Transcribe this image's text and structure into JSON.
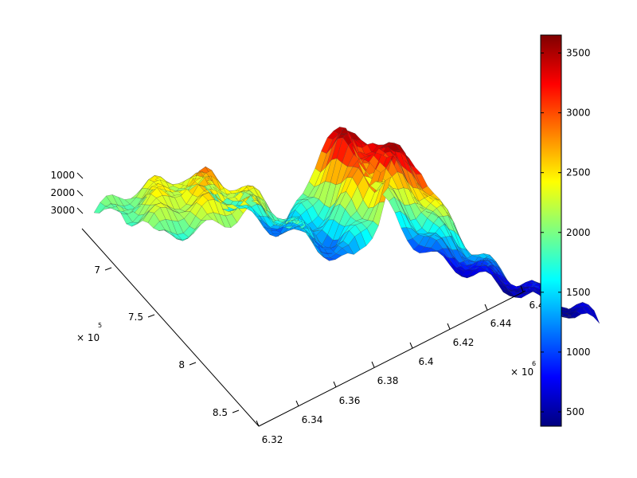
{
  "chart_data": {
    "type": "surface3d",
    "colormap": "jet",
    "x_axis": {
      "ticks": [
        "6.32",
        "6.34",
        "6.36",
        "6.38",
        "6.4",
        "6.42",
        "6.44",
        "6.4"
      ],
      "multiplier": "× 10",
      "exponent": "6",
      "range": [
        6.32,
        6.46
      ]
    },
    "y_axis": {
      "ticks": [
        "7",
        "7.5",
        "8",
        "8.5"
      ],
      "multiplier": "× 10",
      "exponent": "5",
      "range": [
        6.75,
        8.75
      ]
    },
    "z_axis": {
      "ticks": [
        "1000",
        "2000",
        "3000"
      ],
      "range": [
        500,
        3500
      ],
      "reversed": true
    },
    "colorbar": {
      "ticks": [
        "500",
        "1000",
        "1500",
        "2000",
        "2500",
        "3000",
        "3500"
      ],
      "range": [
        380,
        3650
      ]
    },
    "grid": false,
    "legend": "none",
    "surface_profile": [
      [
        6.32,
        2050
      ],
      [
        6.332,
        2400
      ],
      [
        6.345,
        2700
      ],
      [
        6.358,
        2300
      ],
      [
        6.37,
        1600
      ],
      [
        6.38,
        1300
      ],
      [
        6.388,
        2100
      ],
      [
        6.395,
        3350
      ],
      [
        6.402,
        3550
      ],
      [
        6.41,
        2700
      ],
      [
        6.42,
        1700
      ],
      [
        6.43,
        1100
      ],
      [
        6.44,
        900
      ],
      [
        6.45,
        700
      ],
      [
        6.46,
        550
      ]
    ]
  }
}
